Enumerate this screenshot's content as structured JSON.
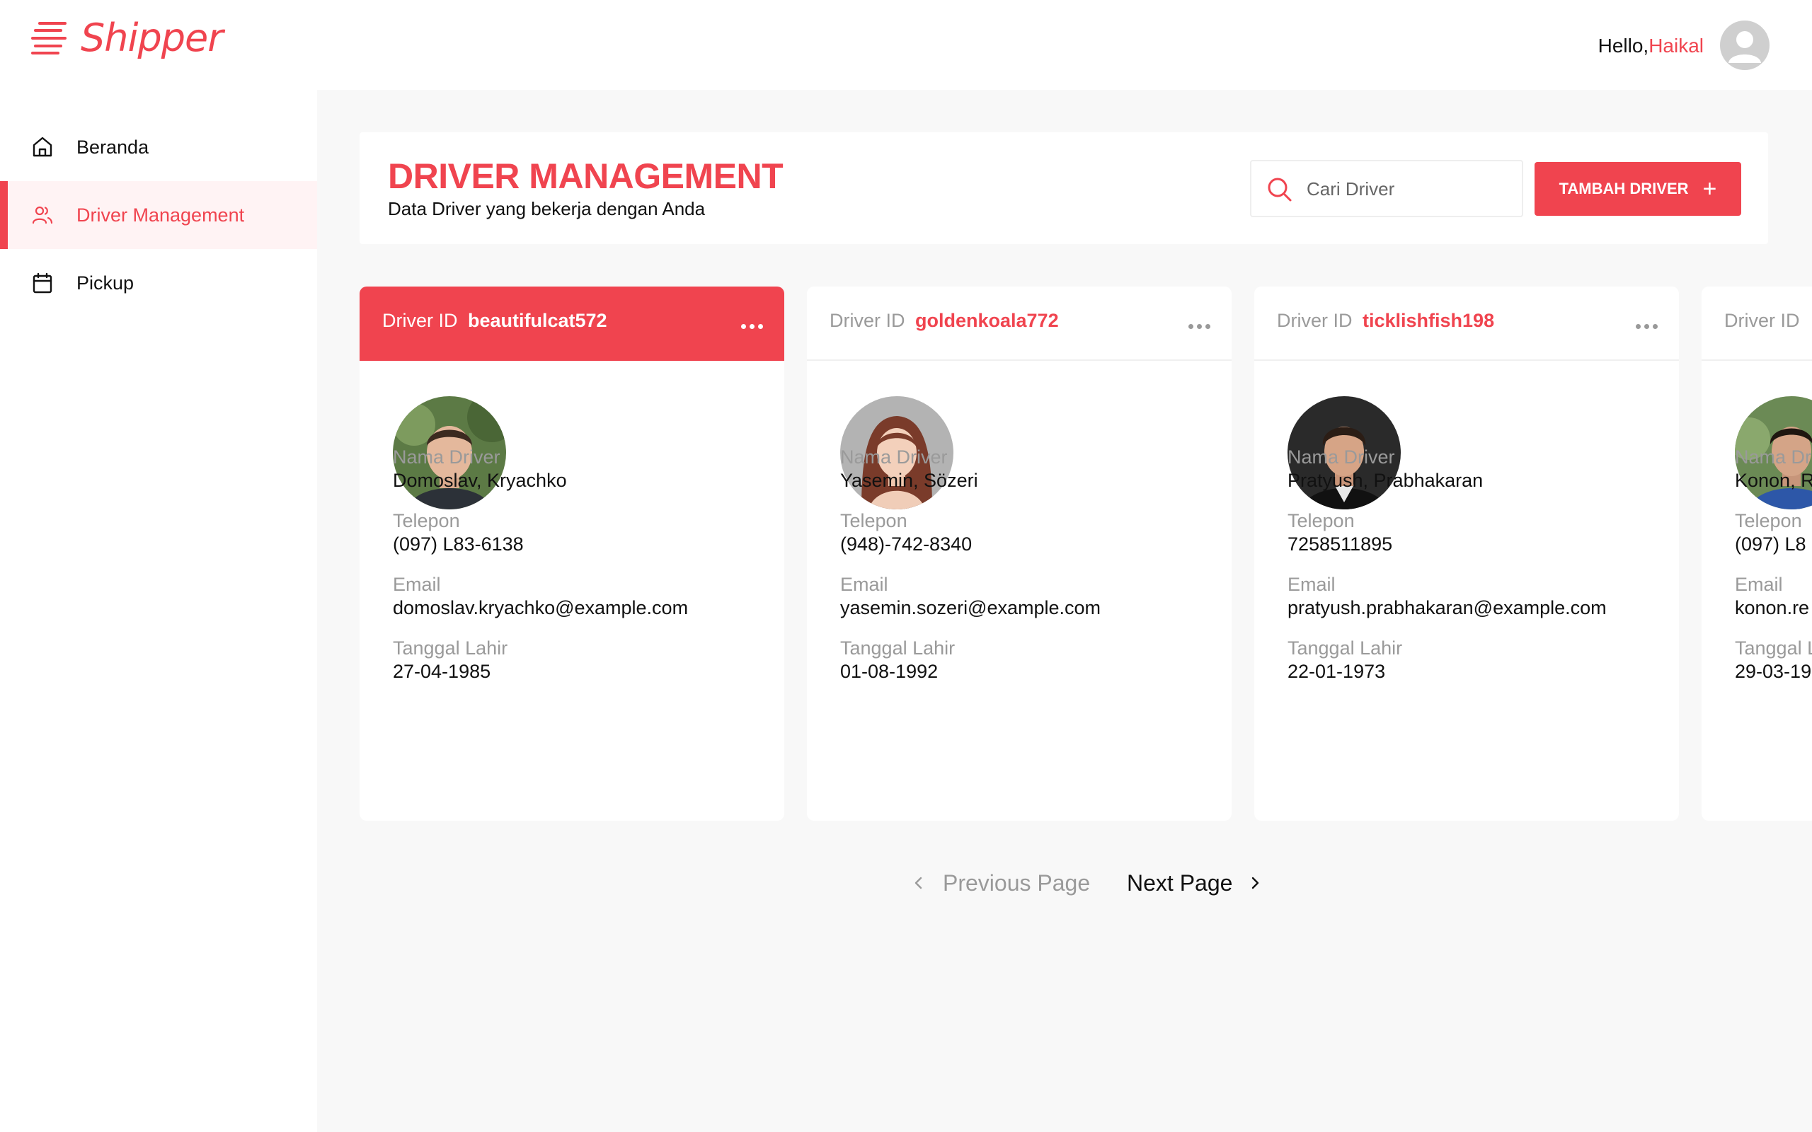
{
  "brand": {
    "name": "Shipper",
    "color": "#f0444f"
  },
  "topbar": {
    "greeting": "Hello,",
    "user_name": "Haikal",
    "avatar_icon": "user-avatar-icon"
  },
  "sidebar": {
    "items": [
      {
        "label": "Beranda",
        "icon": "home-icon",
        "active": false
      },
      {
        "label": "Driver Management",
        "icon": "users-icon",
        "active": true
      },
      {
        "label": "Pickup",
        "icon": "calendar-icon",
        "active": false
      }
    ]
  },
  "header": {
    "title": "DRIVER MANAGEMENT",
    "subtitle": "Data Driver yang bekerja dengan Anda",
    "search_placeholder": "Cari Driver",
    "add_button_label": "TAMBAH DRIVER",
    "add_button_icon": "plus-icon"
  },
  "card_labels": {
    "driver_id": "Driver ID",
    "name": "Nama Driver",
    "phone": "Telepon",
    "email": "Email",
    "dob": "Tanggal Lahir"
  },
  "drivers": [
    {
      "id": "beautifulcat572",
      "name": "Domoslav, Kryachko",
      "phone": "(097) L83-6138",
      "email": "domoslav.kryachko@example.com",
      "dob": "27-04-1985",
      "highlighted": true
    },
    {
      "id": "goldenkoala772",
      "name": "Yasemin, Sözeri",
      "phone": "(948)-742-8340",
      "email": "yasemin.sozeri@example.com",
      "dob": "01-08-1992",
      "highlighted": false
    },
    {
      "id": "ticklishfish198",
      "name": "Pratyush, Prabhakaran",
      "phone": "7258511895",
      "email": "pratyush.prabhakaran@example.com",
      "dob": "22-01-1973",
      "highlighted": false
    },
    {
      "id": "",
      "name": "Konon, R",
      "phone": "(097) L8",
      "email": "konon.re",
      "dob": "29-03-19",
      "highlighted": false
    }
  ],
  "pagination": {
    "prev_label": "Previous Page",
    "next_label": "Next Page"
  }
}
